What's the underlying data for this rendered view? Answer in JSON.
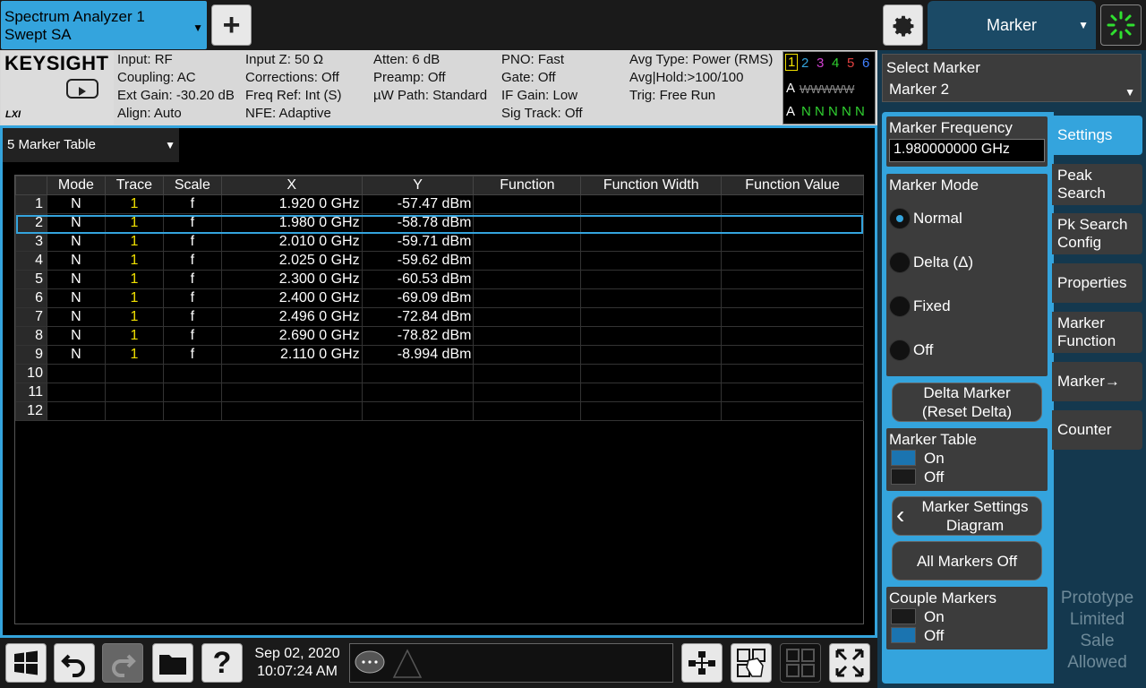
{
  "app_tab": {
    "line1": "Spectrum Analyzer 1",
    "line2": "Swept SA"
  },
  "header": {
    "add_label": "+",
    "mode_tab": "Marker"
  },
  "info": {
    "logo": "KEYSIGHT",
    "lxi": "LXI",
    "col1": [
      "Input: RF",
      "Coupling: AC",
      "Ext Gain: -30.20 dB",
      "Align: Auto"
    ],
    "col2": [
      "Input Z: 50 Ω",
      "Corrections: Off",
      "Freq Ref: Int (S)",
      "NFE: Adaptive"
    ],
    "col3": [
      "Atten: 6 dB",
      "Preamp: Off",
      "µW Path: Standard",
      ""
    ],
    "col4": [
      "PNO: Fast",
      "Gate: Off",
      "IF Gain: Low",
      "Sig Track: Off"
    ],
    "col5": [
      "Avg Type: Power (RMS)",
      "Avg|Hold:>100/100",
      "Trig: Free Run",
      ""
    ],
    "trace_numbers": [
      "1",
      "2",
      "3",
      "4",
      "5",
      "6"
    ],
    "trace_colors": [
      "#f0e000",
      "#34a4dd",
      "#d040d0",
      "#30d030",
      "#e04040",
      "#4080ff"
    ],
    "trace_type_row": "A",
    "trace_type_vals": "WWWWW",
    "trace_det_row": "A",
    "trace_det_vals": "N N N N N"
  },
  "table_dropdown": "5 Marker Table",
  "table": {
    "headers": [
      "",
      "Mode",
      "Trace",
      "Scale",
      "X",
      "Y",
      "Function",
      "Function Width",
      "Function Value"
    ],
    "rows": [
      [
        "1",
        "N",
        "1",
        "f",
        "1.920 0 GHz",
        "-57.47 dBm",
        "",
        "",
        ""
      ],
      [
        "2",
        "N",
        "1",
        "f",
        "1.980 0 GHz",
        "-58.78 dBm",
        "",
        "",
        ""
      ],
      [
        "3",
        "N",
        "1",
        "f",
        "2.010 0 GHz",
        "-59.71 dBm",
        "",
        "",
        ""
      ],
      [
        "4",
        "N",
        "1",
        "f",
        "2.025 0 GHz",
        "-59.62 dBm",
        "",
        "",
        ""
      ],
      [
        "5",
        "N",
        "1",
        "f",
        "2.300 0 GHz",
        "-60.53 dBm",
        "",
        "",
        ""
      ],
      [
        "6",
        "N",
        "1",
        "f",
        "2.400 0 GHz",
        "-69.09 dBm",
        "",
        "",
        ""
      ],
      [
        "7",
        "N",
        "1",
        "f",
        "2.496 0 GHz",
        "-72.84 dBm",
        "",
        "",
        ""
      ],
      [
        "8",
        "N",
        "1",
        "f",
        "2.690 0 GHz",
        "-78.82 dBm",
        "",
        "",
        ""
      ],
      [
        "9",
        "N",
        "1",
        "f",
        "2.110 0 GHz",
        "-8.994 dBm",
        "",
        "",
        ""
      ],
      [
        "10",
        "",
        "",
        "",
        "",
        "",
        "",
        "",
        ""
      ],
      [
        "11",
        "",
        "",
        "",
        "",
        "",
        "",
        "",
        ""
      ],
      [
        "12",
        "",
        "",
        "",
        "",
        "",
        "",
        "",
        ""
      ]
    ],
    "selected_row": 1
  },
  "bottom": {
    "date": "Sep 02, 2020",
    "time": "10:07:24 AM"
  },
  "right": {
    "select_marker_label": "Select Marker",
    "select_marker_value": "Marker 2",
    "freq_label": "Marker Frequency",
    "freq_value": "1.980000000 GHz",
    "mode_label": "Marker Mode",
    "modes": [
      "Normal",
      "Delta (Δ)",
      "Fixed",
      "Off"
    ],
    "delta_btn": [
      "Delta Marker",
      "(Reset Delta)"
    ],
    "table_label": "Marker Table",
    "on": "On",
    "off": "Off",
    "settings_diag": [
      "Marker Settings",
      "Diagram"
    ],
    "all_off": "All Markers Off",
    "couple_label": "Couple Markers",
    "tabs": [
      "Settings",
      "Peak Search",
      "Pk Search Config",
      "Properties",
      "Marker Function",
      "Marker→",
      "Counter"
    ],
    "prototype": [
      "Prototype",
      "Limited",
      "Sale",
      "Allowed"
    ]
  }
}
